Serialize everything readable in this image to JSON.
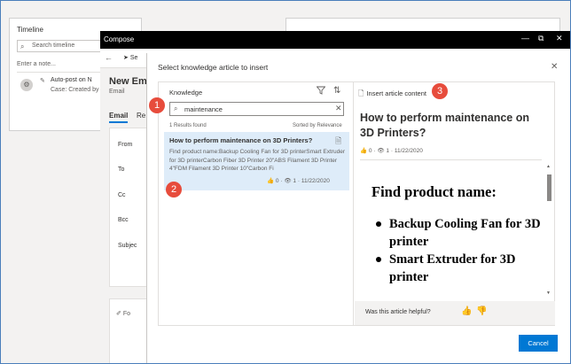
{
  "background": {
    "timeline": {
      "title": "Timeline",
      "search_placeholder": "Search timeline",
      "note_placeholder": "Enter a note...",
      "post_title": "Auto-post on N",
      "post_subtitle": "Case: Created by E"
    }
  },
  "compose": {
    "window_title": "Compose",
    "send_label": "Se",
    "heading": "New Em",
    "subheading": "Email",
    "tabs": [
      "Email",
      "Re"
    ],
    "fields": [
      "From",
      "To",
      "Cc",
      "Bcc",
      "Subjec"
    ],
    "formatting_label": "Fo"
  },
  "dialog": {
    "title": "Select knowledge article to insert",
    "knowledge_label": "Knowledge",
    "search_value": "maintenance",
    "results_found": "1 Results found",
    "sorted_by": "Sorted by Relevance",
    "result": {
      "title": "How to perform maintenance on 3D Printers?",
      "snippet": "Find product name:Backup Cooling Fan for 3D printerSmart Extruder for 3D printerCarbon Fiber 3D Printer 20\"ABS Filament 3D Printer 4\"FDM Filament 3D Printer 10\"Carbon Fi",
      "likes": "0",
      "views": "1",
      "date": "11/22/2020"
    },
    "preview": {
      "insert_label": "Insert article content",
      "title": "How to perform maintenance on 3D Printers?",
      "likes": "0",
      "views": "1",
      "date": "11/22/2020",
      "content_heading": "Find product name:",
      "content_items": [
        "Backup Cooling Fan for 3D printer",
        "Smart Extruder for 3D printer"
      ],
      "helpful_question": "Was this article helpful?"
    },
    "cancel_label": "Cancel"
  },
  "callouts": [
    "1",
    "2",
    "3"
  ],
  "colors": {
    "accent": "#0078d4",
    "callout": "#e74c3c",
    "selected_result": "#deecf9",
    "titlebar": "#000000"
  }
}
